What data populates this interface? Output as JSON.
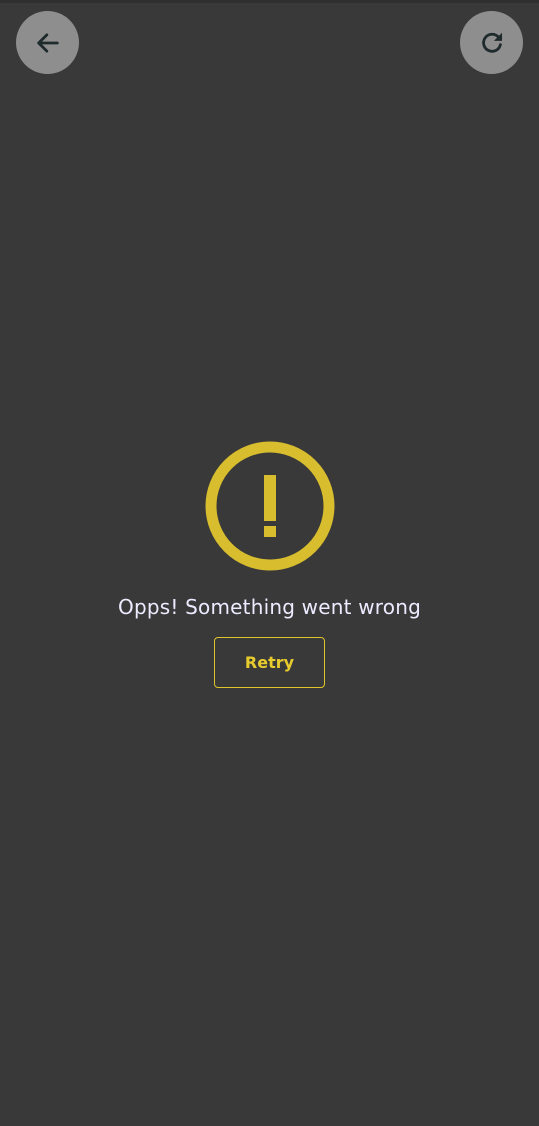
{
  "header": {
    "back_button": {
      "icon": "arrow-left-icon"
    },
    "refresh_button": {
      "icon": "refresh-icon"
    }
  },
  "error": {
    "icon": "alert-circle-icon",
    "message": "Opps! Something went wrong",
    "retry_label": "Retry"
  },
  "colors": {
    "background": "#393939",
    "accent": "#d8bd2e",
    "button_circle": "#8e8e8e",
    "message_text": "#ecebff",
    "icon_dark": "#1f2a2c"
  }
}
